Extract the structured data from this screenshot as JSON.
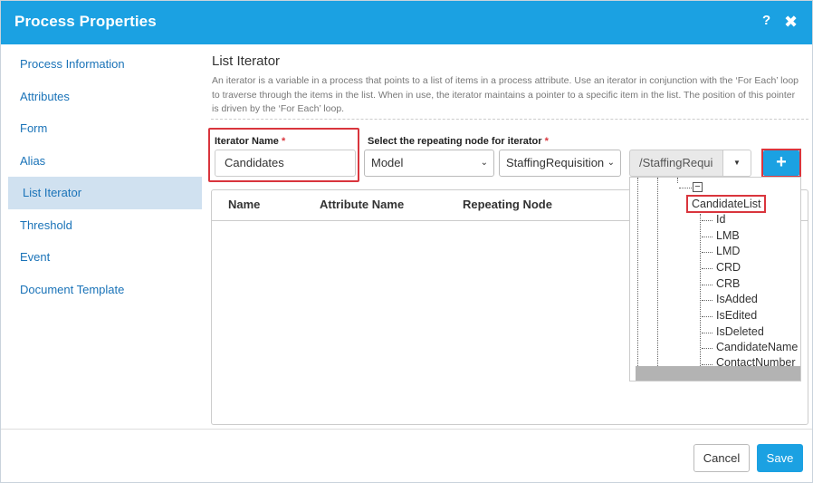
{
  "dialog": {
    "title": "Process Properties",
    "help_glyph": "?",
    "close_glyph": "✖"
  },
  "sidebar": {
    "items": [
      {
        "label": "Process Information"
      },
      {
        "label": "Attributes"
      },
      {
        "label": "Form"
      },
      {
        "label": "Alias"
      },
      {
        "label": "List Iterator",
        "active": true
      },
      {
        "label": "Threshold"
      },
      {
        "label": "Event"
      },
      {
        "label": "Document Template"
      }
    ]
  },
  "main": {
    "heading": "List Iterator",
    "description": "An iterator is a variable in a process that points to a list of items in a process attribute. Use an iterator in conjunction with the ‘For Each’ loop to traverse through the items in the list. When in use, the iterator maintains a pointer to a specific item in the list. The position of this pointer is driven by the ‘For Each’ loop.",
    "iterator_label": "Iterator Name",
    "iterator_value": "Candidates",
    "repeating_label": "Select the repeating node for iterator",
    "required_mark": "*",
    "select1_value": "Model",
    "select2_value": "StaffingRequisition",
    "path_value": "/StaffingRequi",
    "caret_glyph": "▼",
    "add_glyph": "+"
  },
  "table": {
    "columns": [
      "Name",
      "Attribute Name",
      "Repeating Node"
    ]
  },
  "tree": {
    "minus_glyph": "−",
    "parent": "CandidateList",
    "children": [
      "Id",
      "LMB",
      "LMD",
      "CRD",
      "CRB",
      "IsAdded",
      "IsEdited",
      "IsDeleted",
      "CandidateName",
      "ContactNumber"
    ]
  },
  "footer": {
    "cancel_label": "Cancel",
    "save_label": "Save"
  },
  "colors": {
    "accent": "#1ba1e2",
    "highlight_border": "#d9353d",
    "active_sidebar_bg": "#d0e1f0",
    "link_text": "#1a73b8"
  }
}
